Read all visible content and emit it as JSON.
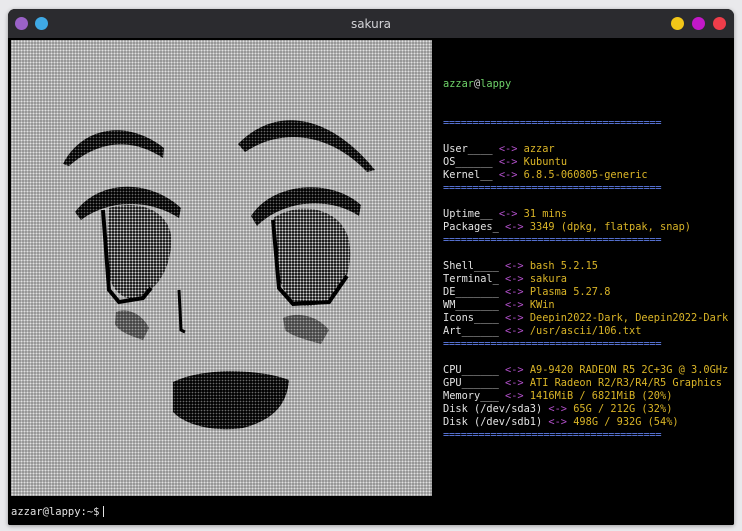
{
  "window": {
    "title": "sakura",
    "colors": {
      "dot1": "#9a62c8",
      "dot2": "#3fa9e5",
      "minimize": "#f2c618",
      "maximize": "#c318c8",
      "close": "#ef3d4a"
    }
  },
  "info": {
    "user": "azzar",
    "at": "@",
    "host": "lappy",
    "separator": "=====================================",
    "arrow": "<->",
    "groups": [
      [
        {
          "key": "User____",
          "value": "azzar"
        },
        {
          "key": "OS______",
          "value": "Kubuntu"
        },
        {
          "key": "Kernel__",
          "value": "6.8.5-060805-generic"
        }
      ],
      [
        {
          "key": "Uptime__",
          "value": "31 mins"
        },
        {
          "key": "Packages_",
          "value": "3349 (dpkg, flatpak, snap)"
        }
      ],
      [
        {
          "key": "Shell____",
          "value": "bash 5.2.15"
        },
        {
          "key": "Terminal_",
          "value": "sakura"
        },
        {
          "key": "DE_______",
          "value": "Plasma 5.27.8"
        },
        {
          "key": "WM_______",
          "value": "KWin"
        },
        {
          "key": "Icons____",
          "value": "Deepin2022-Dark, Deepin2022-Dark"
        },
        {
          "key": "Art______",
          "value": "/usr/ascii/106.txt"
        }
      ],
      [
        {
          "key": "CPU______",
          "value": "A9-9420 RADEON R5 2C+3G @ 3.0GHz"
        },
        {
          "key": "GPU______",
          "value": "ATI Radeon R2/R3/R4/R5 Graphics"
        },
        {
          "key": "Memory___",
          "value": "1416MiB / 6821MiB (20%)"
        },
        {
          "key": "Disk (/dev/sda3)",
          "value": "65G / 212G (32%)"
        },
        {
          "key": "Disk (/dev/sdb1)",
          "value": "498G / 932G (54%)"
        }
      ]
    ]
  },
  "prompt": "azzar@lappy:~$"
}
